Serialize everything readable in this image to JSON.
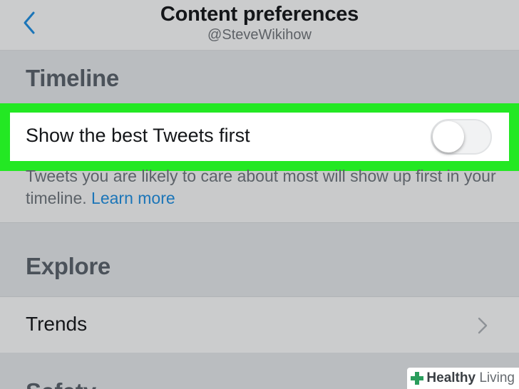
{
  "header": {
    "title": "Content preferences",
    "subtitle": "@SteveWikihow",
    "back_icon": "chevron-left-icon",
    "accent": "#1b75b8"
  },
  "timeline": {
    "heading": "Timeline",
    "best_tweets_label": "Show the best Tweets first",
    "toggle_on": false,
    "description": "Tweets you are likely to care about most will show up first in your timeline.",
    "learn_more": "Learn more",
    "highlight_color": "#23e823"
  },
  "explore": {
    "heading": "Explore",
    "trends_label": "Trends",
    "trends_icon": "chevron-right-icon"
  },
  "next_section": {
    "heading": "Safety"
  },
  "watermark": {
    "brand_bold": "Healthy",
    "brand_light": "Living",
    "icon": "plus-cross-icon"
  }
}
